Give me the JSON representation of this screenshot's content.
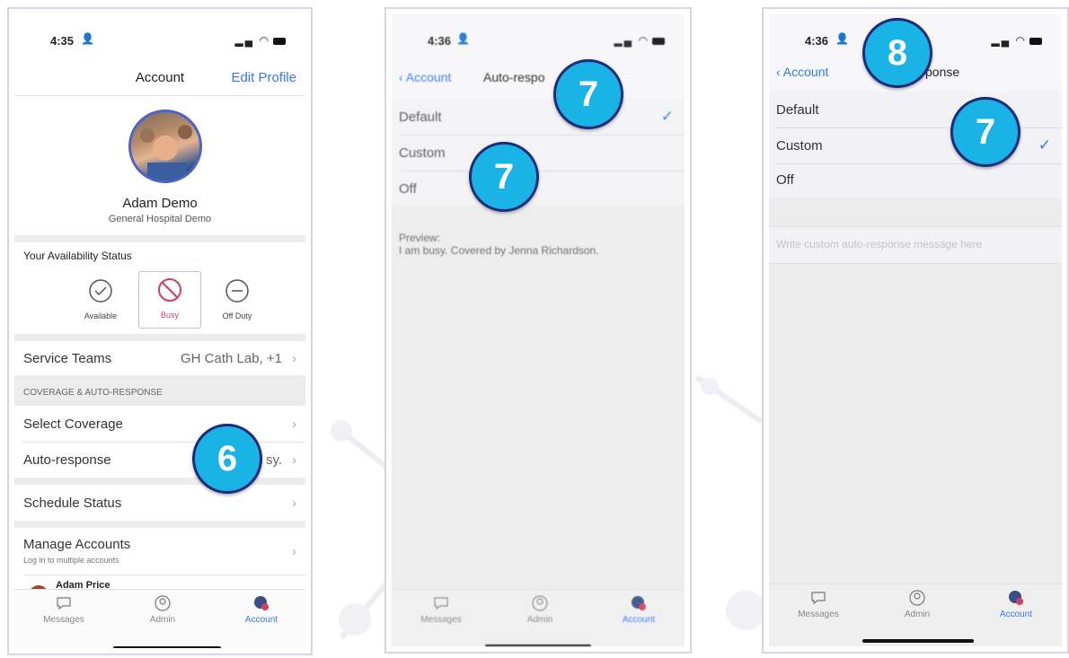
{
  "screen1": {
    "time": "4:35",
    "nav_title": "Account",
    "edit_profile": "Edit Profile",
    "user_name": "Adam Demo",
    "org": "General Hospital Demo",
    "availability_heading": "Your Availability Status",
    "statuses": [
      "Available",
      "Busy",
      "Off Duty"
    ],
    "service_teams_label": "Service Teams",
    "service_teams_value": "GH Cath Lab, +1",
    "section_header": "COVERAGE & AUTO-RESPONSE",
    "select_coverage": "Select Coverage",
    "auto_response": "Auto-response",
    "auto_response_value": "sy.",
    "schedule_status": "Schedule Status",
    "manage_accounts": "Manage Accounts",
    "manage_accounts_sub": "Log in to multiple accounts",
    "other_account": "Adam Price",
    "badge": "6"
  },
  "screen2": {
    "time": "4:36",
    "back_label": "Account",
    "nav_title": "Auto-respo",
    "options": [
      "Default",
      "Custom",
      "Off"
    ],
    "check": "✓",
    "preview_label": "Preview:",
    "preview_text": "I am busy. Covered by Jenna Richardson.",
    "badges": [
      "7",
      "7"
    ]
  },
  "screen3": {
    "time": "4:36",
    "back_label": "Account",
    "nav_title": "ponse",
    "options": [
      "Default",
      "Custom",
      "Off"
    ],
    "check": "✓",
    "custom_placeholder": "Write custom auto-response message here",
    "badges": [
      "8",
      "7"
    ]
  },
  "tabs": [
    "Messages",
    "Admin",
    "Account"
  ],
  "colors": {
    "accent": "#3478f6",
    "badge_fill": "#1ab3e6",
    "badge_border": "#1c2a7a",
    "busy": "#d0405a"
  }
}
